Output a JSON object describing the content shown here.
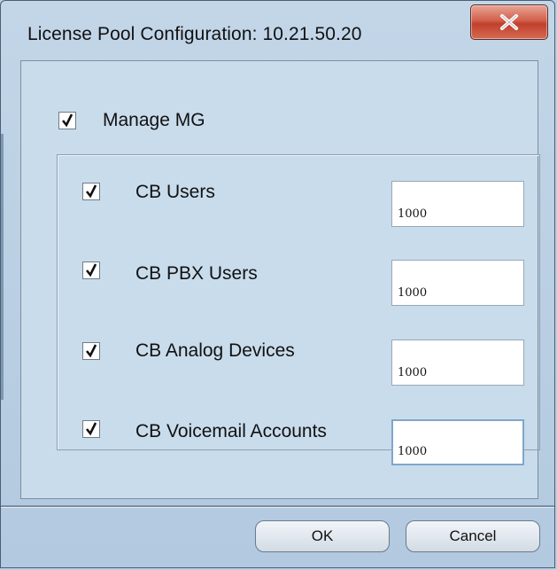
{
  "window": {
    "title": "License Pool Configuration: 10.21.50.20",
    "close_icon": "close-icon"
  },
  "manage_mg": {
    "label": "Manage MG",
    "checked": true
  },
  "items": [
    {
      "label": "CB Users",
      "checked": true,
      "value": "1000"
    },
    {
      "label": "CB PBX Users",
      "checked": true,
      "value": "1000"
    },
    {
      "label": "CB Analog Devices",
      "checked": true,
      "value": "1000"
    },
    {
      "label": "CB Voicemail Accounts",
      "checked": true,
      "value": "1000"
    }
  ],
  "buttons": {
    "ok": "OK",
    "cancel": "Cancel"
  }
}
